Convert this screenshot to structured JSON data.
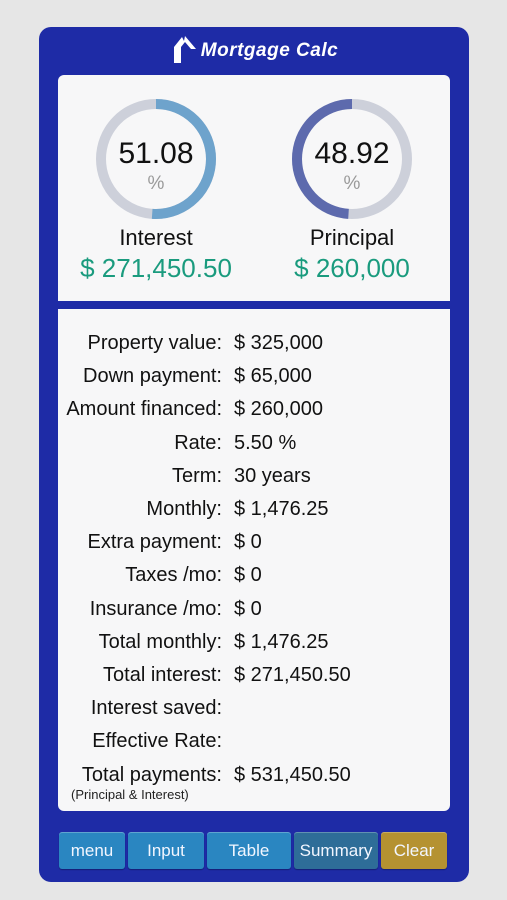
{
  "app": {
    "title": "Mortgage Calc"
  },
  "summary": {
    "interest": {
      "percent": "51.08",
      "unit": "%",
      "label": "Interest",
      "amount": "$ 271,450.50",
      "fraction": 0.5108,
      "color": "#6ea3cc"
    },
    "principal": {
      "percent": "48.92",
      "unit": "%",
      "label": "Principal",
      "amount": "$ 260,000",
      "fraction": 0.4892,
      "color": "#5d6aad"
    }
  },
  "details": {
    "rows": [
      {
        "label": "Property value:",
        "value": "$ 325,000"
      },
      {
        "label": "Down payment:",
        "value": "$ 65,000"
      },
      {
        "label": "Amount financed:",
        "value": "$ 260,000"
      },
      {
        "label": "Rate:",
        "value": "5.50 %"
      },
      {
        "label": "Term:",
        "value": "30 years"
      },
      {
        "label": "Monthly:",
        "value": "$ 1,476.25"
      },
      {
        "label": "Extra payment:",
        "value": "$ 0"
      },
      {
        "label": "Taxes /mo:",
        "value": "$ 0"
      },
      {
        "label": "Insurance /mo:",
        "value": "$ 0"
      },
      {
        "label": "Total monthly:",
        "value": "$ 1,476.25"
      },
      {
        "label": "Total interest:",
        "value": "$ 271,450.50"
      },
      {
        "label": "Interest saved:",
        "value": ""
      },
      {
        "label": "Effective Rate:",
        "value": ""
      },
      {
        "label": "Total payments:",
        "value": "$ 531,450.50"
      }
    ],
    "note": "(Principal & Interest)"
  },
  "toolbar": {
    "buttons": [
      {
        "label": "menu",
        "color": "#2a86c1"
      },
      {
        "label": "Input",
        "color": "#2a86c1"
      },
      {
        "label": "Table",
        "color": "#2a86c1"
      },
      {
        "label": "Summary",
        "color": "#2e6d98"
      },
      {
        "label": "Clear",
        "color": "#b59231"
      }
    ]
  },
  "colors": {
    "frame": "#1e2ba6",
    "panel": "#f7f7f8",
    "amount": "#1a9b7e",
    "track": "#cdd0da"
  }
}
